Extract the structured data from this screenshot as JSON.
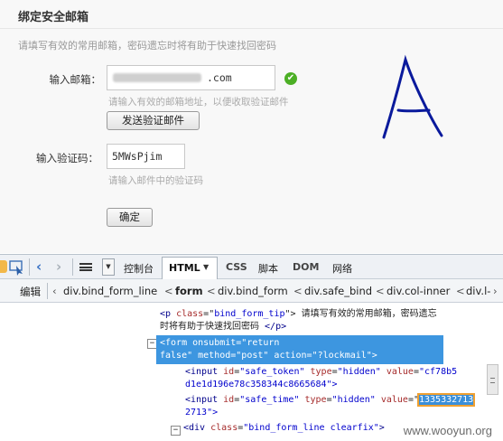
{
  "form": {
    "title": "绑定安全邮箱",
    "description": "请填写有效的常用邮箱，密码遗忘时将有助于快速找回密码",
    "email_label": "输入邮箱：",
    "email_value": ".com",
    "email_hint": "请输入有效的邮箱地址，以便收取验证邮件",
    "send_button": "发送验证邮件",
    "code_label": "输入验证码：",
    "code_value": "5MWsPjim",
    "code_hint": "请输入邮件中的验证码",
    "confirm_button": "确定",
    "check_glyph": "✔",
    "handwriting": "A"
  },
  "devtools": {
    "toolbar": {
      "console": "控制台",
      "html": "HTML",
      "css": "CSS",
      "script": "脚本",
      "dom": "DOM",
      "network": "网络"
    },
    "breadcrumb": {
      "edit": "编辑",
      "items": [
        "div.bind_form_line",
        "form",
        "div.bind_form",
        "div.safe_bind",
        "div.col-inner",
        "div.l-"
      ]
    },
    "code": {
      "l1_open": "<p ",
      "l1_attr": "class",
      "l1_eq": "=\"",
      "l1_val": "bind_form_tip",
      "l1_close": "\">",
      "l1_text": " 请填写有效的常用邮箱，密码遗忘",
      "l2_text": "时将有助于快速找回密码 ",
      "l2_end": "</p>",
      "form_line1": "<form onsubmit=\"return",
      "form_line2": "false\" method=\"post\" action=\"?lockmail\">",
      "in1_a": "<input ",
      "in1_id": "id",
      "in1_idv": "\"safe_token\"",
      "in1_type": "type",
      "in1_typev": "\"hidden\"",
      "in1_value": "value",
      "in1_valuev": "\"cf78b5",
      "in1_cont": "d1e1d196e78c358344c8665684\">",
      "in2_a": "<input ",
      "in2_id": "id",
      "in2_idv": "\"safe_time\"",
      "in2_type": "type",
      "in2_typev": "\"hidden\"",
      "in2_value": "value",
      "in2_eq": "=\"",
      "in2_highlight": "1335332713",
      "in2_cont": "2713\">",
      "div_a": "<div ",
      "div_attr": "class",
      "div_val": "\"bind_form_line clearfix\"",
      "div_close": ">",
      "expander": "−"
    },
    "watermark": "www.wooyun.org"
  }
}
